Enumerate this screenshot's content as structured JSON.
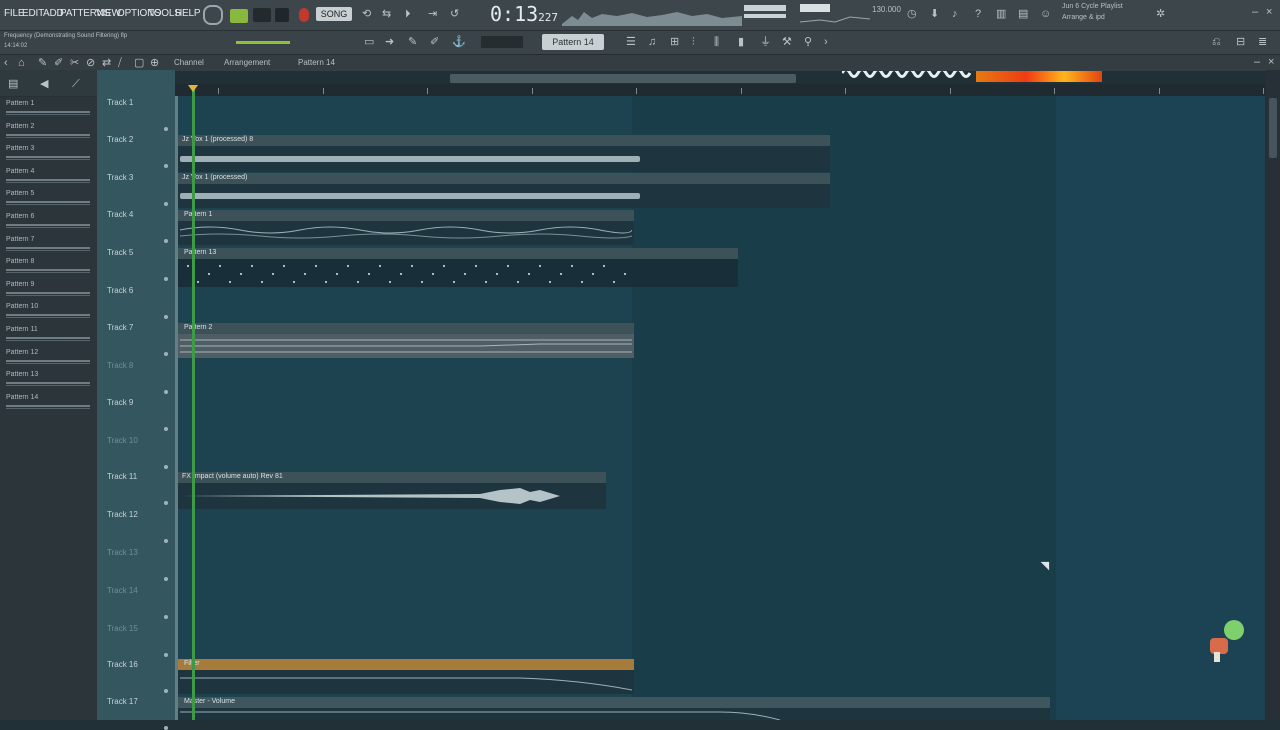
{
  "menu": {
    "items": [
      "FILE",
      "EDIT",
      "ADD",
      "PATTERNS",
      "VIEW",
      "OPTIONS",
      "TOOLS",
      "HELP"
    ]
  },
  "title_hint": "Frequency (Demonstrating Sound Filtering) flp",
  "title_sub": "14:14:02",
  "transport": {
    "mode": "SONG",
    "time": "0:13",
    "time_small": "227",
    "tempo": "130.000"
  },
  "pattern_selector": "Pattern 14",
  "tool_tabs": {
    "channel": "Channel",
    "view": "Arrangement",
    "pattern": "Pattern 14"
  },
  "hint_text": {
    "line1": "Jun 6 Cycle Playlist",
    "line2": "Arrange & ipd"
  },
  "browser": {
    "patterns": [
      "Pattern 1",
      "Pattern 2",
      "Pattern 3",
      "Pattern 4",
      "Pattern 5",
      "Pattern 6",
      "Pattern 7",
      "Pattern 8",
      "Pattern 9",
      "Pattern 10",
      "Pattern 11",
      "Pattern 12",
      "Pattern 13",
      "Pattern 14"
    ]
  },
  "tracks": [
    "Track 1",
    "Track 2",
    "Track 3",
    "Track 4",
    "Track 5",
    "Track 6",
    "Track 7",
    "Track 8",
    "Track 9",
    "Track 10",
    "Track 11",
    "Track 12",
    "Track 13",
    "Track 14",
    "Track 15",
    "Track 16",
    "Track 17"
  ],
  "clips": {
    "c1": "Jz Vox 1 (processed) 8",
    "c2": "Jz Vox 1 (processed)",
    "c3": "Pattern 1",
    "c4": "Pattern 13",
    "c5": "Pattern 2",
    "c6": "FX Impact (volume auto) Rev 81",
    "c7": "Filter",
    "c8": "Master - Volume"
  },
  "colors": {
    "accent": "#3f9a47",
    "clip_header": "#3d5158",
    "grid": "#1d4250",
    "vu": "#f03b12"
  }
}
